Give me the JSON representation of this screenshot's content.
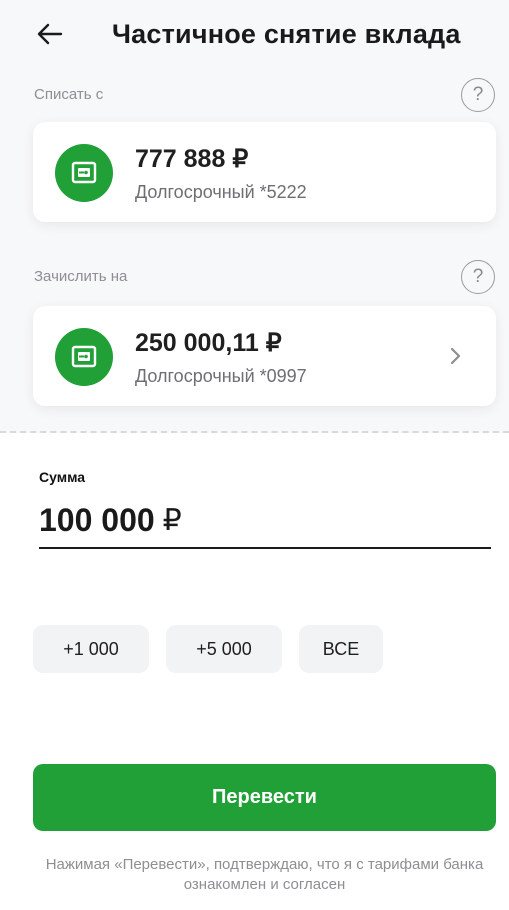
{
  "header": {
    "title": "Частичное снятие вклада"
  },
  "from": {
    "label": "Списать с",
    "amount": "777 888 ₽",
    "name": "Долгосрочный *5222"
  },
  "to": {
    "label": "Зачислить на",
    "amount": "250 000,11 ₽",
    "name": "Долгосрочный *0997"
  },
  "help": {
    "symbol": "?"
  },
  "sum": {
    "label": "Сумма",
    "value": "100 000",
    "currency": "₽"
  },
  "quick_amounts": [
    "+1 000",
    "+5 000",
    "ВСЕ"
  ],
  "primary_button": {
    "label": "Перевести"
  },
  "disclaimer": "Нажимая «Перевести», подтверждаю, что я с тарифами банка ознакомлен и согласен",
  "colors": {
    "accent": "#21a038",
    "text_secondary": "#8e8e93"
  },
  "icons": {
    "back": "arrow-left-icon",
    "deposit": "safe-icon",
    "chevron": "chevron-right-icon",
    "help": "question-circle-icon"
  }
}
